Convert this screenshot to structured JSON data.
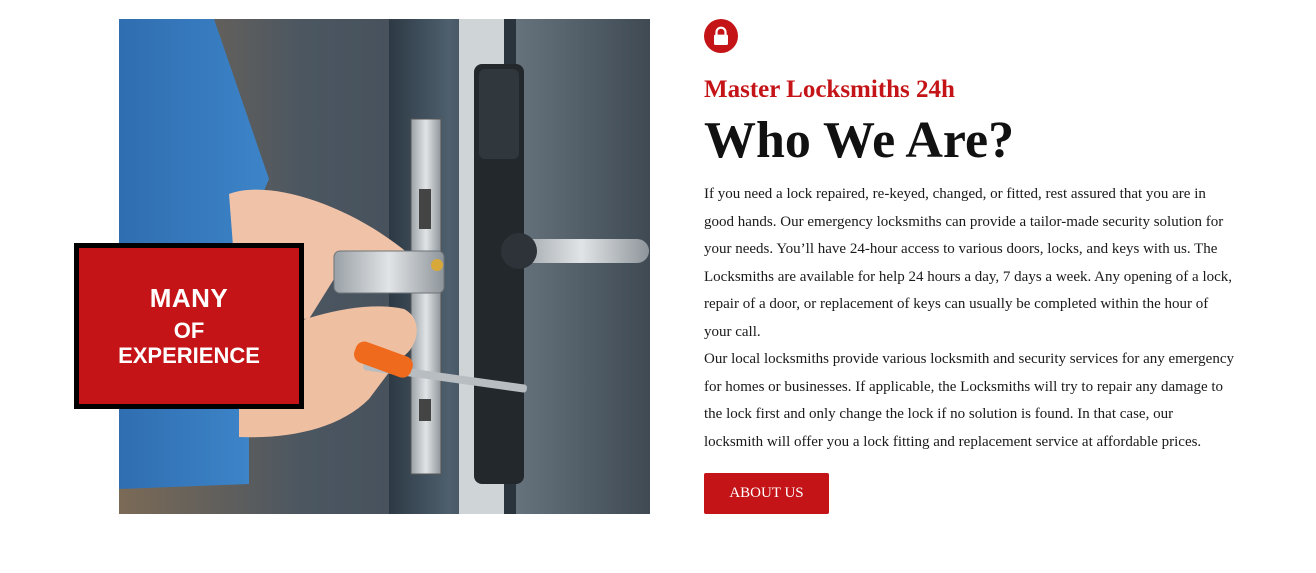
{
  "colors": {
    "accent": "#c41417",
    "text": "#111111"
  },
  "badge": {
    "line1": "MANY",
    "line2": "OF",
    "line3": "EXPERIENCE"
  },
  "header": {
    "icon": "lock-icon",
    "subtitle": "Master Locksmiths 24h",
    "title": "Who We Are?"
  },
  "body": {
    "paragraph1": "If you need a lock repaired, re-keyed, changed, or fitted, rest assured that you are in good hands. Our emergency locksmiths can provide a tailor-made security solution for your needs. You’ll have 24-hour access to various doors, locks, and keys with us. The Locksmiths are available for help 24 hours a day, 7 days a week. Any opening of a lock, repair of a door, or replacement of keys can usually be completed within the hour of your call.",
    "paragraph2": "Our local locksmiths provide various locksmith and security services for any emergency for homes or businesses. If applicable, the Locksmiths will try to repair any damage to the lock first and only change the lock if no solution is found. In that case, our locksmith will offer you a lock fitting and replacement service at affordable prices."
  },
  "cta": {
    "label": "ABOUT US"
  }
}
